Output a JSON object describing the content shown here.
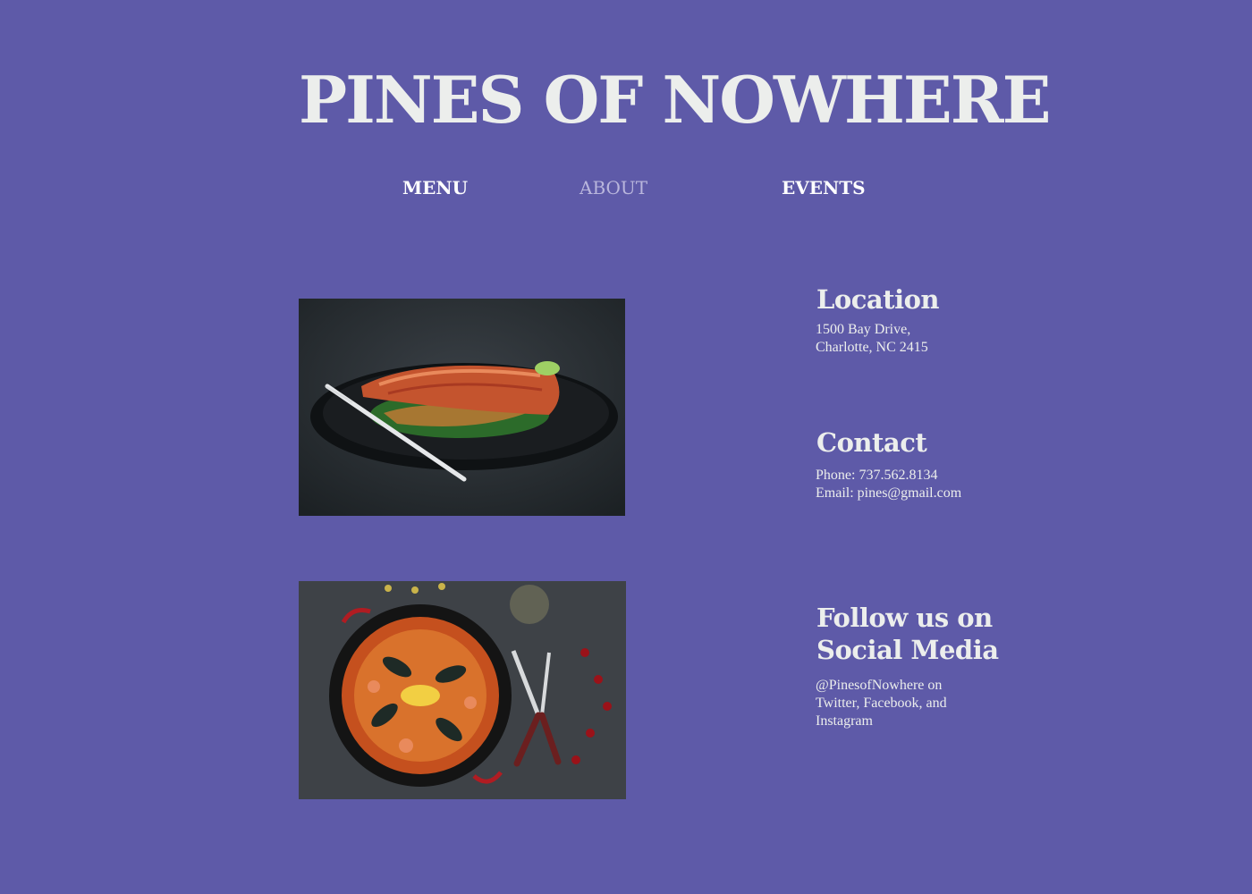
{
  "site": {
    "title": "PINES OF NOWHERE"
  },
  "nav": {
    "items": [
      {
        "label": "MENU",
        "active": false
      },
      {
        "label": "ABOUT",
        "active": true
      },
      {
        "label": "EVENTS",
        "active": false
      }
    ]
  },
  "location": {
    "heading": "Location",
    "line1": "1500 Bay Drive,",
    "line2": "Charlotte, NC 2415"
  },
  "contact": {
    "heading": "Contact",
    "phone": "Phone: 737.562.8134",
    "email": "Email: pines@gmail.com"
  },
  "social": {
    "heading_line1": "Follow us on",
    "heading_line2": "Social Media",
    "text_line1": "@PinesofNowhere on",
    "text_line2": "Twitter, Facebook, and",
    "text_line3": "Instagram"
  },
  "colors": {
    "background": "#5e5aa8",
    "text": "#eceeec",
    "nav_active": "#b9b6dc"
  }
}
